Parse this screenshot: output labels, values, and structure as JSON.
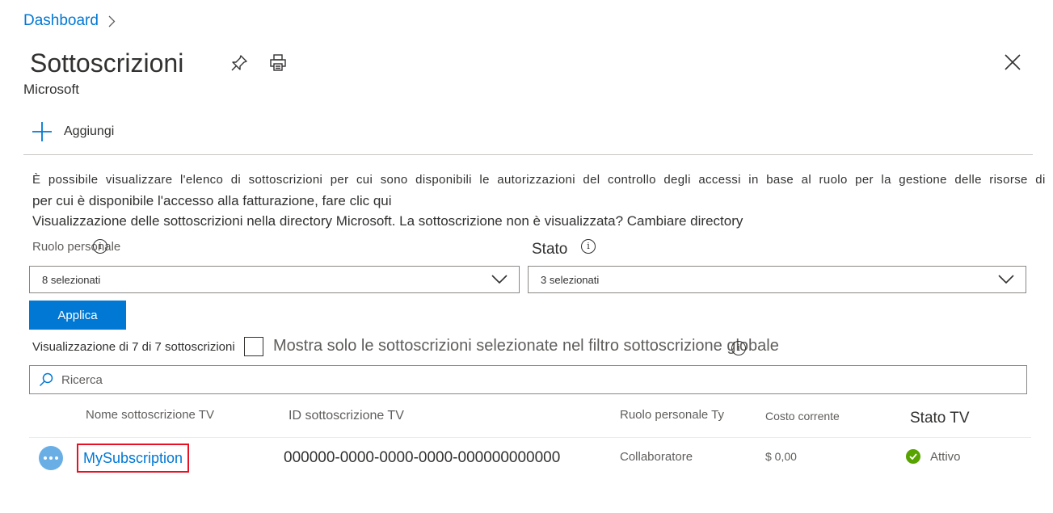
{
  "breadcrumb": {
    "label": "Dashboard"
  },
  "header": {
    "title": "Sottoscrizioni",
    "subtitle": "Microsoft",
    "icons": [
      "pin-icon",
      "print-icon",
      "close-icon"
    ]
  },
  "toolbar": {
    "add_label": "Aggiungi"
  },
  "info": {
    "line1": "È possibile visualizzare l'elenco di sottoscrizioni per cui sono disponibili le autorizzazioni del controllo degli accessi in base al ruolo per la gestione delle risorse di",
    "line2": "per cui è disponibile l'accesso alla fatturazione, fare clic qui",
    "line3": "Visualizzazione delle sottoscrizioni nella directory Microsoft. La sottoscrizione non è visualizzata? Cambiare directory"
  },
  "filters": {
    "role_label": "Ruolo personale",
    "role_value": "8 selezionati",
    "state_label": "Stato",
    "state_value": "3 selezionati",
    "apply_label": "Applica"
  },
  "listing": {
    "count_text": "Visualizzazione di 7 di 7 sottoscrizioni",
    "only_selected_text": "Mostra solo le sottoscrizioni selezionate nel filtro sottoscrizione globale"
  },
  "search": {
    "placeholder": "Ricerca"
  },
  "table": {
    "headers": {
      "name": "Nome sottoscrizione TV",
      "id": "ID sottoscrizione TV",
      "role": "Ruolo personale Ty",
      "cost": "Costo corrente",
      "state": "Stato TV"
    },
    "rows": [
      {
        "name": "MySubscription",
        "id": "000000-0000-0000-0000-000000000000",
        "role": "Collaboratore",
        "cost": "$ 0,00",
        "status": "Attivo"
      }
    ]
  },
  "colors": {
    "accent": "#0078d4",
    "status_ok": "#57a300",
    "highlight_border": "#e81123",
    "more_button": "#69afe5"
  }
}
